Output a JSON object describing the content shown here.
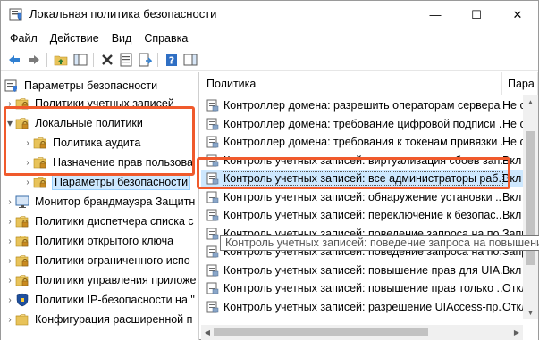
{
  "window": {
    "title": "Локальная политика безопасности",
    "minimize_glyph": "—",
    "maximize_glyph": "☐",
    "close_glyph": "✕"
  },
  "menu": [
    "Файл",
    "Действие",
    "Вид",
    "Справка"
  ],
  "toolbar": {
    "buttons": [
      "back-icon",
      "forward-icon",
      "up-folder-icon",
      "show-tree-icon",
      "delete-icon",
      "properties-icon",
      "export-list-icon",
      "help-icon",
      "show-action-pane-icon"
    ]
  },
  "tree": {
    "root": "Параметры безопасности",
    "items": [
      {
        "label": "Политики учетных записей",
        "level": 1,
        "expanded": false
      },
      {
        "label": "Локальные политики",
        "level": 1,
        "expanded": true
      },
      {
        "label": "Политика аудита",
        "level": 2,
        "expanded": false
      },
      {
        "label": "Назначение прав пользова",
        "level": 2,
        "expanded": false
      },
      {
        "label": "Параметры безопасности",
        "level": 2,
        "expanded": false,
        "selected": true
      },
      {
        "label": "Монитор брандмауэра Защитн",
        "level": 1,
        "expanded": false
      },
      {
        "label": "Политики диспетчера списка с",
        "level": 1,
        "expanded": false
      },
      {
        "label": "Политики открытого ключа",
        "level": 1,
        "expanded": false
      },
      {
        "label": "Политики ограниченного испо",
        "level": 1,
        "expanded": false
      },
      {
        "label": "Политики управления приложе",
        "level": 1,
        "expanded": false
      },
      {
        "label": "Политики IP-безопасности на \"",
        "level": 1,
        "expanded": false
      },
      {
        "label": "Конфигурация расширенной п",
        "level": 1,
        "expanded": false
      }
    ]
  },
  "list": {
    "columns": [
      "Политика",
      "Пара"
    ],
    "rows": [
      {
        "name": "Контроллер домена: разрешить операторам сервера ...",
        "value": "Не о"
      },
      {
        "name": "Контроллер домена: требование цифровой подписи ...",
        "value": "Не о"
      },
      {
        "name": "Контроллер домена: требования к токенам привязки ...",
        "value": "Не о"
      },
      {
        "name": "Контроль учетных записей: виртуализация сбоев зап...",
        "value": "Вкл"
      },
      {
        "name": "Контроль учетных записей: все администраторы раб...",
        "value": "Вкл",
        "selected": true
      },
      {
        "name": "Контроль учетных записей: обнаружение установки ...",
        "value": "Вкл"
      },
      {
        "name": "Контроль учетных записей: переключение к безопас...",
        "value": "Вкл"
      },
      {
        "name": "Контроль учетных записей: поведение запроса на по...",
        "value": "Запр"
      },
      {
        "name": "Контроль учетных записей: поведение запроса на по...",
        "value": "Запр"
      },
      {
        "name": "Контроль учетных записей: повышение прав для UIA...",
        "value": "Вкл"
      },
      {
        "name": "Контроль учетных записей: повышение прав только ...",
        "value": "Откл"
      },
      {
        "name": "Контроль учетных записей: разрешение UIAccess-пр...",
        "value": "Откл"
      }
    ],
    "tooltip": "Контроль учетных записей: поведение запроса на повышение п"
  },
  "colors": {
    "highlight": "#f05a2c",
    "selection": "#cde8ff",
    "folder": "#e8c35a"
  }
}
